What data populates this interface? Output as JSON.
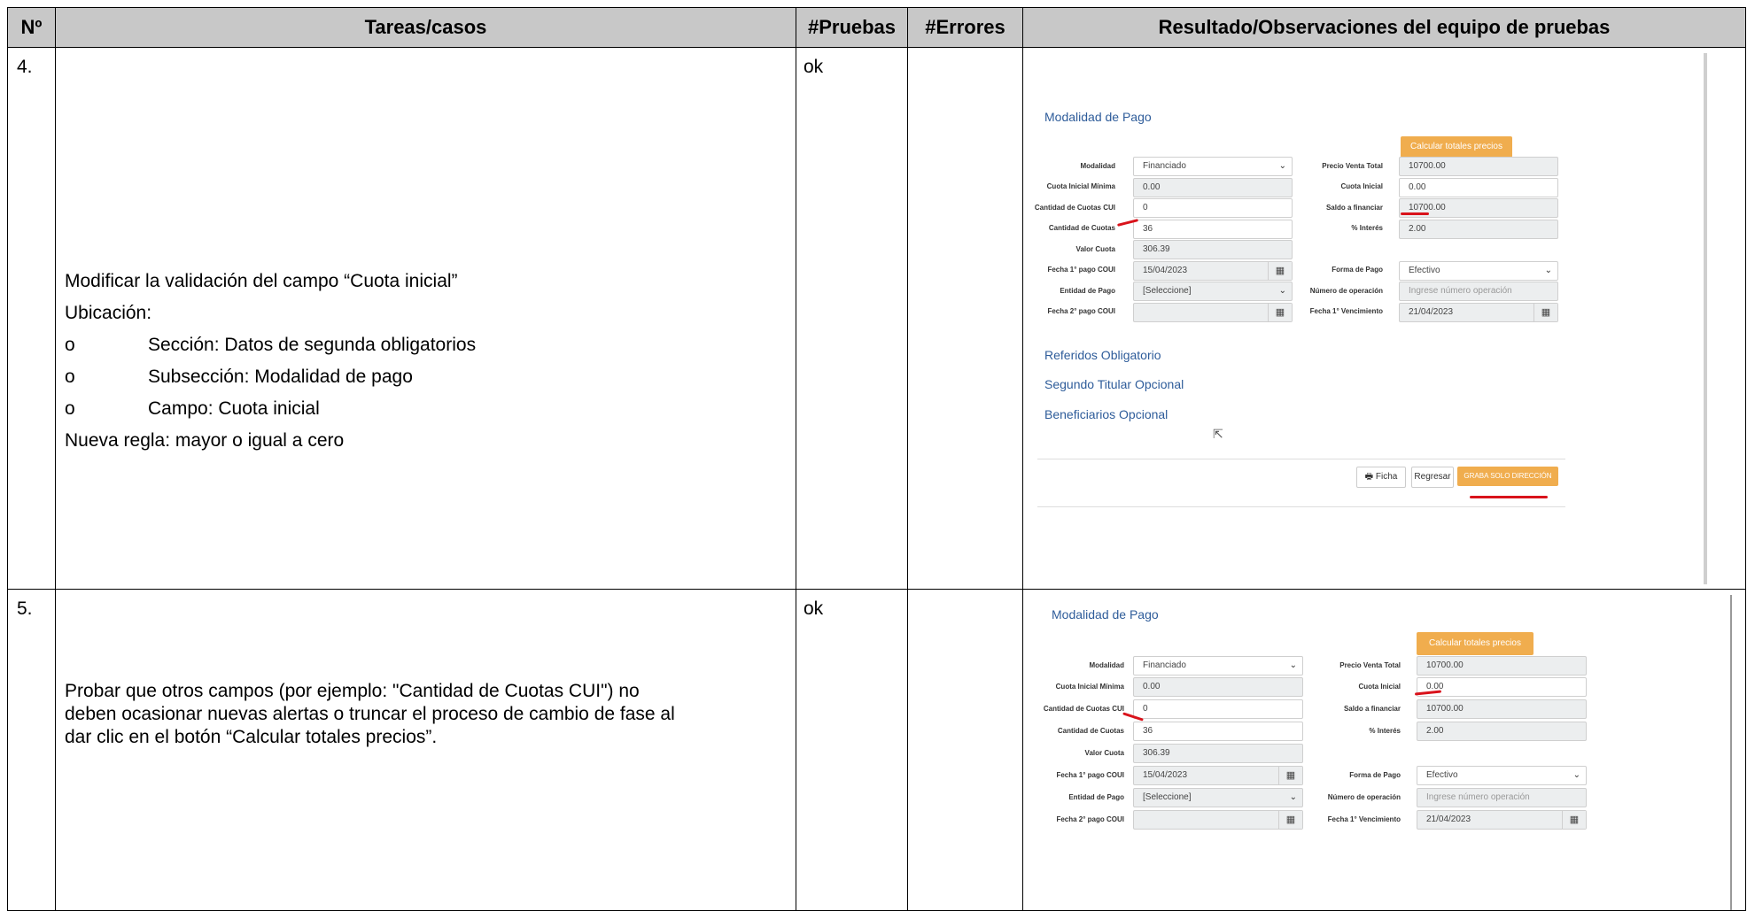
{
  "table": {
    "headers": {
      "num": "Nº",
      "task": "Tareas/casos",
      "tests": "#Pruebas",
      "errors": "#Errores",
      "result": "Resultado/Observaciones del equipo de pruebas"
    },
    "rows": [
      {
        "num": "4.",
        "tests": "ok",
        "errors": "",
        "task": {
          "line1": "Modificar la validación del campo “Cuota inicial”",
          "line2": "Ubicación:",
          "bullets": [
            {
              "marker": "o",
              "text": "Sección: Datos de segunda obligatorios"
            },
            {
              "marker": "o",
              "text": "Subsección: Modalidad de pago"
            },
            {
              "marker": "o",
              "text": "Campo: Cuota inicial"
            }
          ],
          "line3": "Nueva regla: mayor o igual a cero"
        }
      },
      {
        "num": "5.",
        "tests": "ok",
        "errors": "",
        "task": {
          "line1": "Probar que otros campos (por ejemplo: \"Cantidad de Cuotas CUI\") no",
          "line2": "deben ocasionar nuevas alertas o truncar el proceso de cambio de fase al",
          "line3": "dar clic en el botón “Calcular totales precios”."
        }
      }
    ]
  },
  "form": {
    "section_title": "Modalidad de Pago",
    "calc_button": "Calcular totales precios",
    "labels": {
      "modalidad": "Modalidad",
      "cuota_min": "Cuota Inicial Mínima",
      "cant_cui": "Cantidad de Cuotas CUI",
      "cant_cuotas": "Cantidad de Cuotas",
      "valor_cuota": "Valor Cuota",
      "fecha1": "Fecha 1° pago COUI",
      "entidad": "Entidad de Pago",
      "fecha2": "Fecha 2° pago COUI",
      "precio_total": "Precio Venta Total",
      "cuota_inicial": "Cuota Inicial",
      "saldo": "Saldo a financiar",
      "interes": "% Interés",
      "forma_pago": "Forma de Pago",
      "num_operacion": "Número de operación",
      "fecha_venc": "Fecha 1° Vencimiento"
    },
    "values": {
      "modalidad": "Financiado",
      "cuota_min": "0.00",
      "cant_cui": "0",
      "cant_cuotas": "36",
      "valor_cuota": "306.39",
      "fecha1": "15/04/2023",
      "entidad": "[Seleccione]",
      "fecha2": "",
      "precio_total": "10700.00",
      "cuota_inicial": "0.00",
      "saldo": "10700.00",
      "interes": "2.00",
      "forma_pago": "Efectivo",
      "num_operacion_placeholder": "Ingrese número operación",
      "fecha_venc": "21/04/2023"
    },
    "links": {
      "referidos": "Referidos Obligatorio",
      "segundo": "Segundo Titular Opcional",
      "beneficiarios": "Beneficiarios Opcional"
    },
    "buttons": {
      "ficha": "Ficha",
      "regresar": "Regresar",
      "graba": "GRABA SOLO DIRECCIÓN"
    },
    "icons": {
      "chevron": "chevron-down-icon",
      "calendar": "calendar-icon",
      "print": "print-icon",
      "cursor": "mouse-cursor-icon"
    },
    "colors": {
      "accent_orange": "#f0ad4e",
      "link_blue": "#2e5c9a",
      "annotation_red": "#d9131b",
      "header_gray": "#c8c8c8"
    }
  }
}
